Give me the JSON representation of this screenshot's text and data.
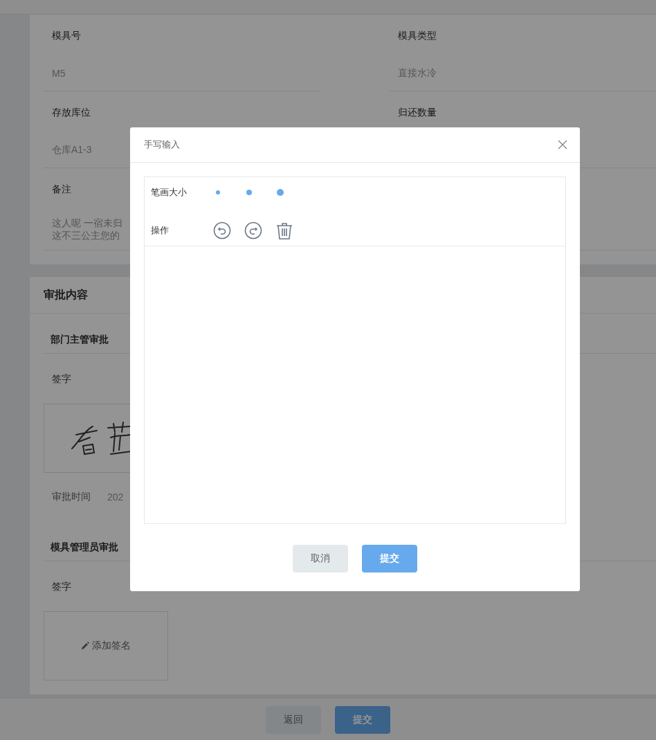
{
  "form": {
    "fields": [
      {
        "label": "模具号",
        "value": "M5"
      },
      {
        "label": "模具类型",
        "value": "直接水冷"
      },
      {
        "label": "存放库位",
        "value": "仓库A1-3"
      },
      {
        "label": "归还数量"
      }
    ],
    "remark": {
      "label": "备注",
      "lines": [
        "这人呢 一宿未归",
        "这不三公主您的"
      ]
    }
  },
  "approval": {
    "title": "审批内容",
    "sections": [
      {
        "title": "部门主管审批",
        "signature_label": "签字",
        "signed": true,
        "time_label": "审批时间",
        "time": "202"
      },
      {
        "title": "模具管理员审批",
        "signature_label": "签字",
        "signed": false,
        "add_signature": "添加签名"
      }
    ]
  },
  "footer": {
    "buttons": [
      {
        "label": "返回",
        "kind": "secondary"
      },
      {
        "label": "提交",
        "kind": "primary"
      }
    ]
  },
  "dialog": {
    "title": "手写输入",
    "pen_size_label": "笔画大小",
    "actions_label": "操作",
    "buttons": [
      {
        "label": "取消",
        "kind": "secondary"
      },
      {
        "label": "提交",
        "kind": "primary"
      }
    ]
  }
}
